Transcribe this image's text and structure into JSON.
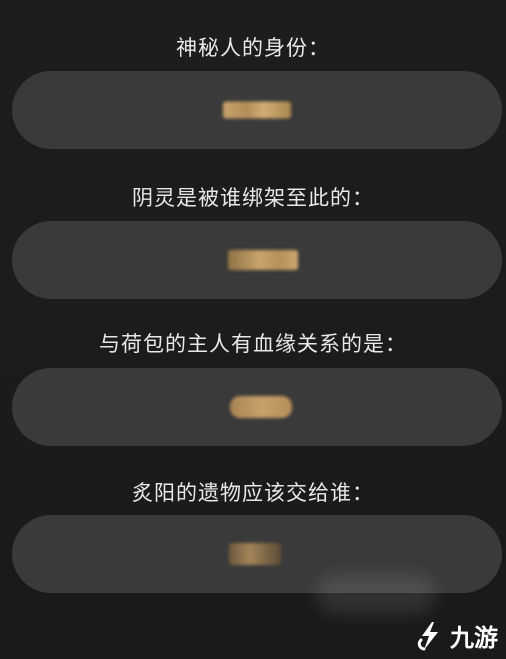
{
  "questions": [
    {
      "text": "神秘人的身份：",
      "answer_state": "blurred"
    },
    {
      "text": "阴灵是被谁绑架至此的：",
      "answer_state": "blurred"
    },
    {
      "text": "与荷包的主人有血缘关系的是：",
      "answer_state": "blurred"
    },
    {
      "text": "炙阳的遗物应该交给谁：",
      "answer_state": "blurred"
    }
  ],
  "watermark": {
    "text": "九游",
    "icon": "jiuyou-logo-icon"
  },
  "colors": {
    "background": "#1c1c1c",
    "answer_box": "#3a3a3a",
    "question_text": "#e9e9e9",
    "blur_answer": "#c9a36b"
  }
}
